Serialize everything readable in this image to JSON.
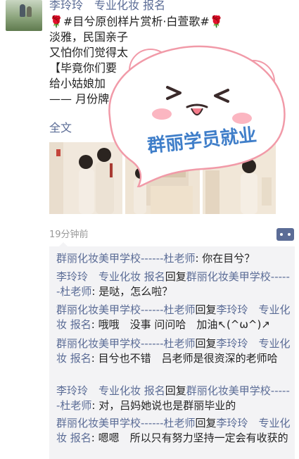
{
  "post": {
    "author": "李玲玲　专业化妆 报名",
    "lines": [
      "🌹#目兮原创样片赏析·白萱歌#🌹",
      "淡雅，民国亲子",
      "又怕你们觉得太",
      "【毕竟你们要",
      "给小姑娘加",
      "—— 月份牌"
    ],
    "fulltext_label": "全文",
    "time": "19分钟前"
  },
  "sticker": {
    "text": "群丽学员就业"
  },
  "comments": [
    {
      "from": "群丽化妆美甲学校------杜老师",
      "reply_word": "",
      "to": "",
      "text": ": 你在目兮？"
    },
    {
      "from": "李玲玲　专业化妆 报名",
      "reply_word": "回复",
      "to": "群丽化妆美甲学校------杜老师",
      "text": ": 是哒，怎么啦？"
    },
    {
      "from": "群丽化妆美甲学校------杜老师",
      "reply_word": "回复",
      "to": "李玲玲　专业化妆 报名",
      "text": ": 哦哦　没事 问问哈　加油↖(^ω^)↗"
    },
    {
      "from": "群丽化妆美甲学校------杜老师",
      "reply_word": "回复",
      "to": "李玲玲　专业化妆 报名",
      "text": ": 目兮也不错　吕老师是很资深的老师哈"
    },
    {
      "from": "李玲玲　专业化妆 报名",
      "reply_word": "回复",
      "to": "群丽化妆美甲学校------杜老师",
      "text": ": 对，吕妈她说也是群丽毕业的"
    },
    {
      "from": "群丽化妆美甲学校------杜老师",
      "reply_word": "回复",
      "to": "李玲玲　专业化妆 报名",
      "text": ": 嗯嗯　所以只有努力坚持一定会有收获的"
    }
  ]
}
